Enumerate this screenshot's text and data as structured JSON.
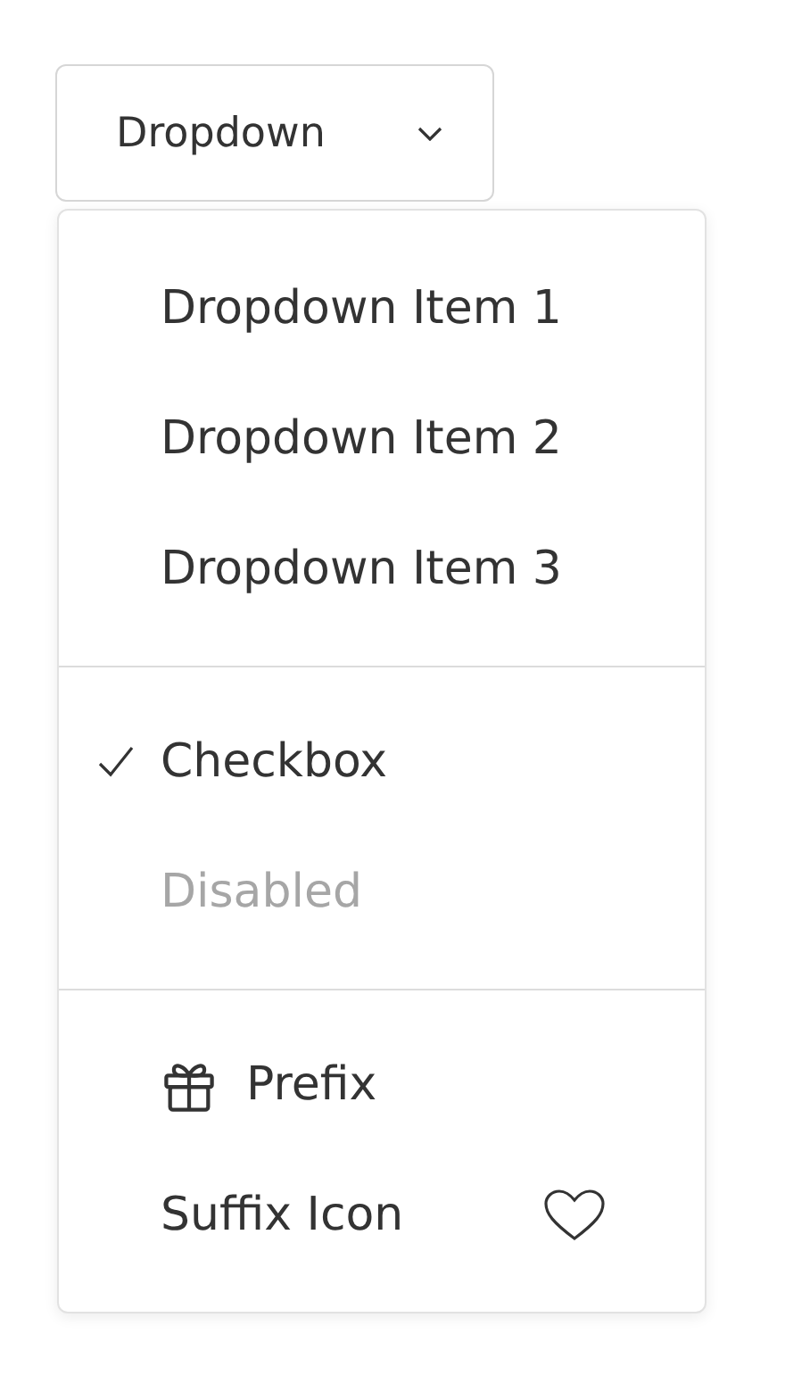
{
  "button": {
    "label": "Dropdown",
    "expanded": true
  },
  "groups": [
    {
      "items": [
        {
          "kind": "plain",
          "label": "Dropdown Item 1"
        },
        {
          "kind": "plain",
          "label": "Dropdown Item 2"
        },
        {
          "kind": "plain",
          "label": "Dropdown Item 3"
        }
      ]
    },
    {
      "items": [
        {
          "kind": "checkbox",
          "label": "Checkbox",
          "checked": true
        },
        {
          "kind": "plain",
          "label": "Disabled",
          "disabled": true
        }
      ]
    },
    {
      "items": [
        {
          "kind": "prefix",
          "label": "Prefix"
        },
        {
          "kind": "suffix",
          "label": "Suffix Icon"
        }
      ]
    }
  ]
}
